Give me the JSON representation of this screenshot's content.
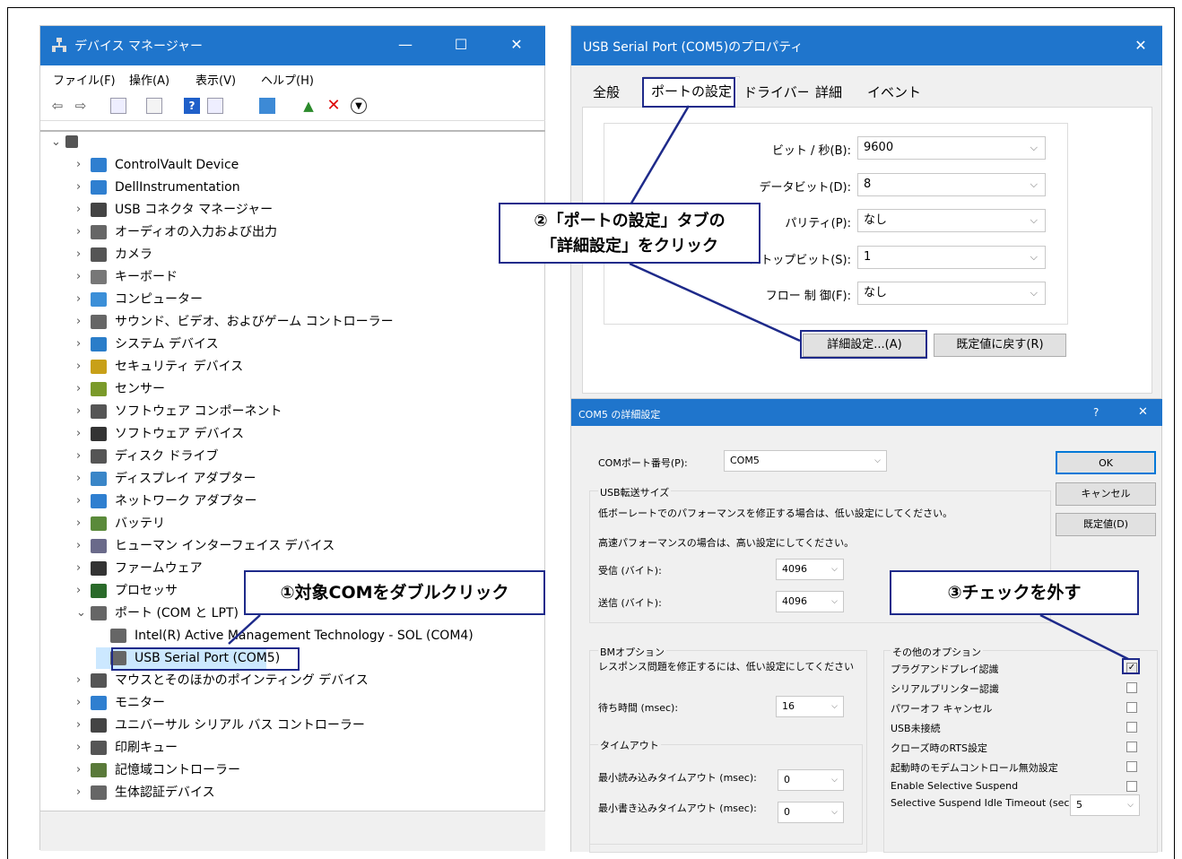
{
  "device_manager": {
    "title": "デバイス マネージャー",
    "window_controls": {
      "minimize": "—",
      "maximize": "☐",
      "close": "✕"
    },
    "menu": [
      "ファイル(F)",
      "操作(A)",
      "表示(V)",
      "ヘルプ(H)"
    ],
    "tree": [
      {
        "label": "ControlVault Device",
        "icon": "monitor-icon"
      },
      {
        "label": "DellInstrumentation",
        "icon": "monitor-icon"
      },
      {
        "label": "USB コネクタ マネージャー",
        "icon": "usb-icon"
      },
      {
        "label": "オーディオの入力および出力",
        "icon": "speaker-icon"
      },
      {
        "label": "カメラ",
        "icon": "camera-icon"
      },
      {
        "label": "キーボード",
        "icon": "keyboard-icon"
      },
      {
        "label": "コンピューター",
        "icon": "computer-icon"
      },
      {
        "label": "サウンド、ビデオ、およびゲーム コントローラー",
        "icon": "speaker-icon"
      },
      {
        "label": "システム デバイス",
        "icon": "folder-icon"
      },
      {
        "label": "セキュリティ デバイス",
        "icon": "security-icon"
      },
      {
        "label": "センサー",
        "icon": "sensor-icon"
      },
      {
        "label": "ソフトウェア コンポーネント",
        "icon": "component-icon"
      },
      {
        "label": "ソフトウェア デバイス",
        "icon": "device-icon"
      },
      {
        "label": "ディスク ドライブ",
        "icon": "disk-icon"
      },
      {
        "label": "ディスプレイ アダプター",
        "icon": "display-icon"
      },
      {
        "label": "ネットワーク アダプター",
        "icon": "network-icon"
      },
      {
        "label": "バッテリ",
        "icon": "battery-icon"
      },
      {
        "label": "ヒューマン インターフェイス デバイス",
        "icon": "hid-icon"
      },
      {
        "label": "ファームウェア",
        "icon": "firmware-icon"
      },
      {
        "label": "プロセッサ",
        "icon": "processor-icon"
      },
      {
        "label": "ポート (COM と LPT)",
        "icon": "port-icon"
      },
      {
        "label": "Intel(R) Active Management Technology - SOL (COM4)",
        "icon": "port-icon"
      },
      {
        "label": "USB Serial Port (COM5)",
        "icon": "port-icon"
      },
      {
        "label": "マウスとそのほかのポインティング デバイス",
        "icon": "mouse-icon"
      },
      {
        "label": "モニター",
        "icon": "monitor-icon"
      },
      {
        "label": "ユニバーサル シリアル バス コントローラー",
        "icon": "usb-icon"
      },
      {
        "label": "印刷キュー",
        "icon": "printer-icon"
      },
      {
        "label": "記憶域コントローラー",
        "icon": "storage-icon"
      },
      {
        "label": "生体認証デバイス",
        "icon": "fingerprint-icon"
      }
    ]
  },
  "properties": {
    "title": "USB Serial Port (COM5)のプロパティ",
    "close": "✕",
    "tabs": [
      "全般",
      "ポートの設定",
      "ドライバー",
      "詳細",
      "イベント"
    ],
    "fields": [
      {
        "label": "ビット / 秒(B):",
        "value": "9600"
      },
      {
        "label": "データビット(D):",
        "value": "8"
      },
      {
        "label": "パリティ(P):",
        "value": "なし"
      },
      {
        "label": "ストップビット(S):",
        "value": "1"
      },
      {
        "label": "フロー 制 御(F):",
        "value": "なし"
      }
    ],
    "advanced_button": "詳細設定...(A)",
    "restore_button": "既定値に戻す(R)"
  },
  "advanced": {
    "title": "COM5 の詳細設定",
    "help": "?",
    "close": "✕",
    "com_port_label": "COMポート番号(P):",
    "com_port_value": "COM5",
    "usb_group_label": "USB転送サイズ",
    "usb_desc_low": "低ボーレートでのパフォーマンスを修正する場合は、低い設定にしてください。",
    "usb_desc_high": "高速パフォーマンスの場合は、高い設定にしてください。",
    "receive_label": "受信 (バイト):",
    "receive_value": "4096",
    "transmit_label": "送信 (バイト):",
    "transmit_value": "4096",
    "bm_group_label": "BMオプション",
    "bm_desc": "レスポンス問題を修正するには、低い設定にしてください",
    "latency_label": "待ち時間 (msec):",
    "latency_value": "16",
    "timeout_group_label": "タイムアウト",
    "min_read_label": "最小読み込みタイムアウト (msec):",
    "min_read_value": "0",
    "min_write_label": "最小書き込みタイムアウト (msec):",
    "min_write_value": "0",
    "other_group_label": "その他のオプション",
    "options": [
      {
        "label": "プラグアンドプレイ認識",
        "checked": true
      },
      {
        "label": "シリアルプリンター認識",
        "checked": false
      },
      {
        "label": "パワーオフ キャンセル",
        "checked": false
      },
      {
        "label": "USB未接続",
        "checked": false
      },
      {
        "label": "クローズ時のRTS設定",
        "checked": false
      },
      {
        "label": "起動時のモデムコントロール無効設定",
        "checked": false
      },
      {
        "label": "Enable Selective Suspend",
        "checked": false
      }
    ],
    "suspend_label": "Selective Suspend Idle Timeout (secs):",
    "suspend_value": "5",
    "ok": "OK",
    "cancel": "キャンセル",
    "defaults": "既定値(D)"
  },
  "callouts": {
    "step1": "①対象COMをダブルクリック",
    "step2_line1": "②「ポートの設定」タブの",
    "step2_line2": "「詳細設定」をクリック",
    "step3": "③チェックを外す"
  },
  "colors": {
    "titlebar": "#1f75cc",
    "callout_border": "#1e2a8a",
    "selection": "#cce8ff"
  }
}
